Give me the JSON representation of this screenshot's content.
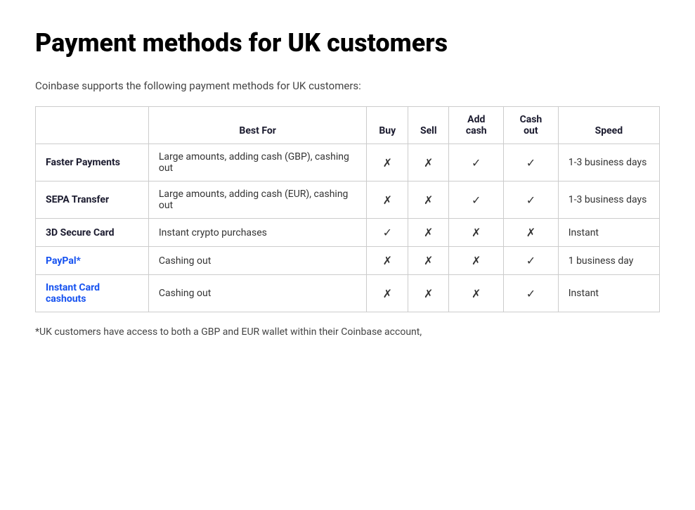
{
  "page": {
    "title": "Payment methods for UK customers",
    "subtitle": "Coinbase supports the following payment methods for UK customers:",
    "footnote": "*UK customers have access to both a GBP and EUR wallet within their Coinbase account,"
  },
  "table": {
    "headers": {
      "name": "",
      "bestFor": "Best For",
      "buy": "Buy",
      "sell": "Sell",
      "addCash": "Add cash",
      "cashOut": "Cash out",
      "speed": "Speed"
    },
    "rows": [
      {
        "name": "Faster Payments",
        "nameStyle": "bold",
        "bestFor": "Large amounts, adding cash (GBP), cashing out",
        "buy": "✗",
        "sell": "✗",
        "addCash": "✓",
        "cashOut": "✓",
        "speed": "1-3 business days"
      },
      {
        "name": "SEPA Transfer",
        "nameStyle": "bold",
        "bestFor": "Large amounts, adding cash (EUR), cashing out",
        "buy": "✗",
        "sell": "✗",
        "addCash": "✓",
        "cashOut": "✓",
        "speed": "1-3 business days"
      },
      {
        "name": "3D Secure Card",
        "nameStyle": "bold",
        "bestFor": "Instant crypto purchases",
        "buy": "✓",
        "sell": "✗",
        "addCash": "✗",
        "cashOut": "✗",
        "speed": "Instant"
      },
      {
        "name": "PayPal*",
        "nameStyle": "blue",
        "bestFor": "Cashing out",
        "buy": "✗",
        "sell": "✗",
        "addCash": "✗",
        "cashOut": "✓",
        "speed": "1 business day"
      },
      {
        "name": "Instant Card cashouts",
        "nameStyle": "blue",
        "bestFor": "Cashing out",
        "buy": "✗",
        "sell": "✗",
        "addCash": "✗",
        "cashOut": "✓",
        "speed": "Instant"
      }
    ]
  }
}
